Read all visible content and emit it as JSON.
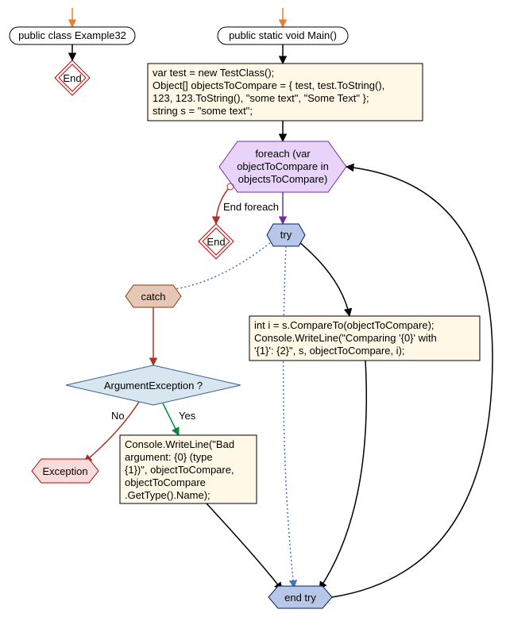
{
  "nodes": {
    "class_decl": "public class Example32",
    "main_decl": "public static void Main()",
    "init_block_l1": "var test = new TestClass();",
    "init_block_l2": "Object[] objectsToCompare = { test, test.ToString(),",
    "init_block_l3": "123, 123.ToString(), \"some text\", \"Some Text\" };",
    "init_block_l4": "string s = \"some text\";",
    "foreach_l1": "foreach (var",
    "foreach_l2": "objectToCompare in",
    "foreach_l3": "objectsToCompare)",
    "end_foreach_label": "End foreach",
    "try_label": "try",
    "catch_label": "catch",
    "try_block_l1": "int i = s.CompareTo(objectToCompare);",
    "try_block_l2": "Console.WriteLine(\"Comparing '{0}' with",
    "try_block_l3": "'{1}': {2}\", s, objectToCompare, i);",
    "argex_label": "ArgumentException ?",
    "catch_block_l1": "Console.WriteLine(\"Bad",
    "catch_block_l2": "argument: {0} (type",
    "catch_block_l3": "{1})\", objectToCompare,",
    "catch_block_l4": "objectToCompare",
    "catch_block_l5": ".GetType().Name);",
    "end_try_label": "end try",
    "exception_label": "Exception",
    "end_label_1": "End",
    "end_label_2": "End",
    "yes_label": "Yes",
    "no_label": "No"
  },
  "colors": {
    "terminal_fill": "#ffffff",
    "terminal_stroke": "#000000",
    "process_fill": "#fff8e6",
    "process_stroke": "#000000",
    "loop_fill": "#e8d4f8",
    "loop_stroke": "#7030a0",
    "try_fill": "#b8c7e8",
    "try_stroke": "#002060",
    "catch_fill": "#e6c7b6",
    "catch_stroke": "#843c0c",
    "decision_fill": "#d8e6f0",
    "decision_stroke": "#376092",
    "exception_fill": "#f8dcdc",
    "exception_stroke": "#c00000",
    "end_stroke": "#c00000",
    "arrow_black": "#000000",
    "arrow_green": "#00863c",
    "arrow_red": "#a8342a",
    "arrow_blue_dotted": "#4472c4",
    "arrow_orange": "#ed7d31",
    "arrow_purple": "#7030a0"
  }
}
